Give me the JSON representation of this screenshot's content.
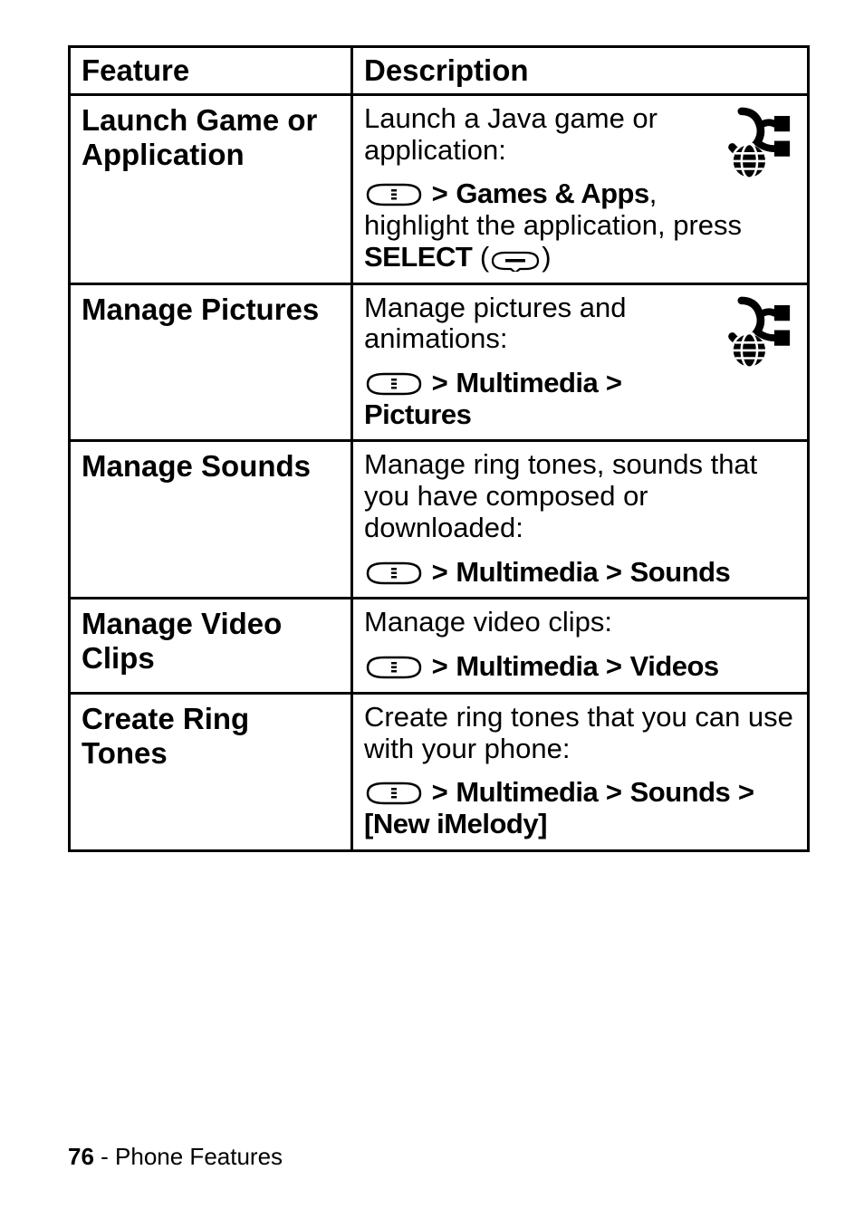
{
  "table": {
    "headers": {
      "feature": "Feature",
      "description": "Description"
    },
    "rows": [
      {
        "feature": "Launch Game or Application",
        "desc_intro": "Launch a Java game or application:",
        "has_icon": true,
        "nav": [
          {
            "prefix_key": "menu",
            "segments": [
              "Games & Apps"
            ],
            "tail": ", highlight the application, press ",
            "suffix_cond": "SELECT",
            "paren_key": "soft"
          }
        ]
      },
      {
        "feature": "Manage Pictures",
        "desc_intro": "Manage pictures and animations:",
        "has_icon": true,
        "nav": [
          {
            "prefix_key": "menu",
            "segments": [
              "Multimedia",
              "Pictures"
            ]
          }
        ]
      },
      {
        "feature": "Manage Sounds",
        "desc_intro": "Manage ring tones, sounds that you have composed or downloaded:",
        "has_icon": false,
        "nav": [
          {
            "prefix_key": "menu",
            "segments": [
              "Multimedia",
              "Sounds"
            ]
          }
        ]
      },
      {
        "feature": "Manage Video Clips",
        "desc_intro": "Manage video clips:",
        "has_icon": false,
        "nav": [
          {
            "prefix_key": "menu",
            "segments": [
              "Multimedia",
              "Videos"
            ]
          }
        ]
      },
      {
        "feature": "Create Ring Tones",
        "desc_intro": "Create ring tones that you can use with your phone:",
        "has_icon": false,
        "nav": [
          {
            "prefix_key": "menu",
            "segments": [
              "Multimedia",
              "Sounds",
              "[New iMelody]"
            ]
          }
        ]
      }
    ]
  },
  "footer": {
    "page": "76",
    "sep": " - ",
    "section": "Phone Features"
  }
}
